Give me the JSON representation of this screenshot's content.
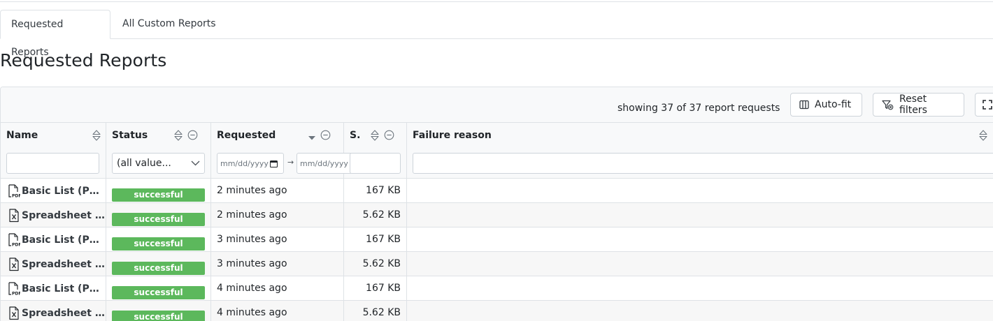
{
  "tabs": [
    {
      "label": "Requested Reports",
      "active": true
    },
    {
      "label": "All Custom Reports",
      "active": false
    }
  ],
  "page_title": "Requested Reports",
  "toolbar": {
    "showing_text": "showing 37 of 37 report requests",
    "autofit_label": "Auto-fit",
    "reset_filters_label": "Reset filters"
  },
  "columns": {
    "name": "Name",
    "status": "Status",
    "requested": "Requested",
    "size": "S.",
    "failure": "Failure reason"
  },
  "filters": {
    "status_select": "(all value...",
    "date_from_placeholder": "mm/dd/yyyy",
    "date_to_placeholder": "mm/dd/yyyy"
  },
  "rows": [
    {
      "icon": "pdf-file-icon",
      "name": "Basic List (Pdf...",
      "status": "successful",
      "requested": "2 minutes ago",
      "size": "167 KB",
      "failure": ""
    },
    {
      "icon": "excel-file-icon",
      "name": "Spreadsheet (...",
      "status": "successful",
      "requested": "2 minutes ago",
      "size": "5.62 KB",
      "failure": ""
    },
    {
      "icon": "pdf-file-icon",
      "name": "Basic List (Pdf...",
      "status": "successful",
      "requested": "3 minutes ago",
      "size": "167 KB",
      "failure": ""
    },
    {
      "icon": "excel-file-icon",
      "name": "Spreadsheet (...",
      "status": "successful",
      "requested": "3 minutes ago",
      "size": "5.62 KB",
      "failure": ""
    },
    {
      "icon": "pdf-file-icon",
      "name": "Basic List (Pdf...",
      "status": "successful",
      "requested": "4 minutes ago",
      "size": "167 KB",
      "failure": ""
    },
    {
      "icon": "excel-file-icon",
      "name": "Spreadsheet (...",
      "status": "successful",
      "requested": "4 minutes ago",
      "size": "5.62 KB",
      "failure": ""
    }
  ],
  "colors": {
    "success": "#5cb85c",
    "border": "#dee2e6",
    "header_bg": "#f8f9fa"
  }
}
